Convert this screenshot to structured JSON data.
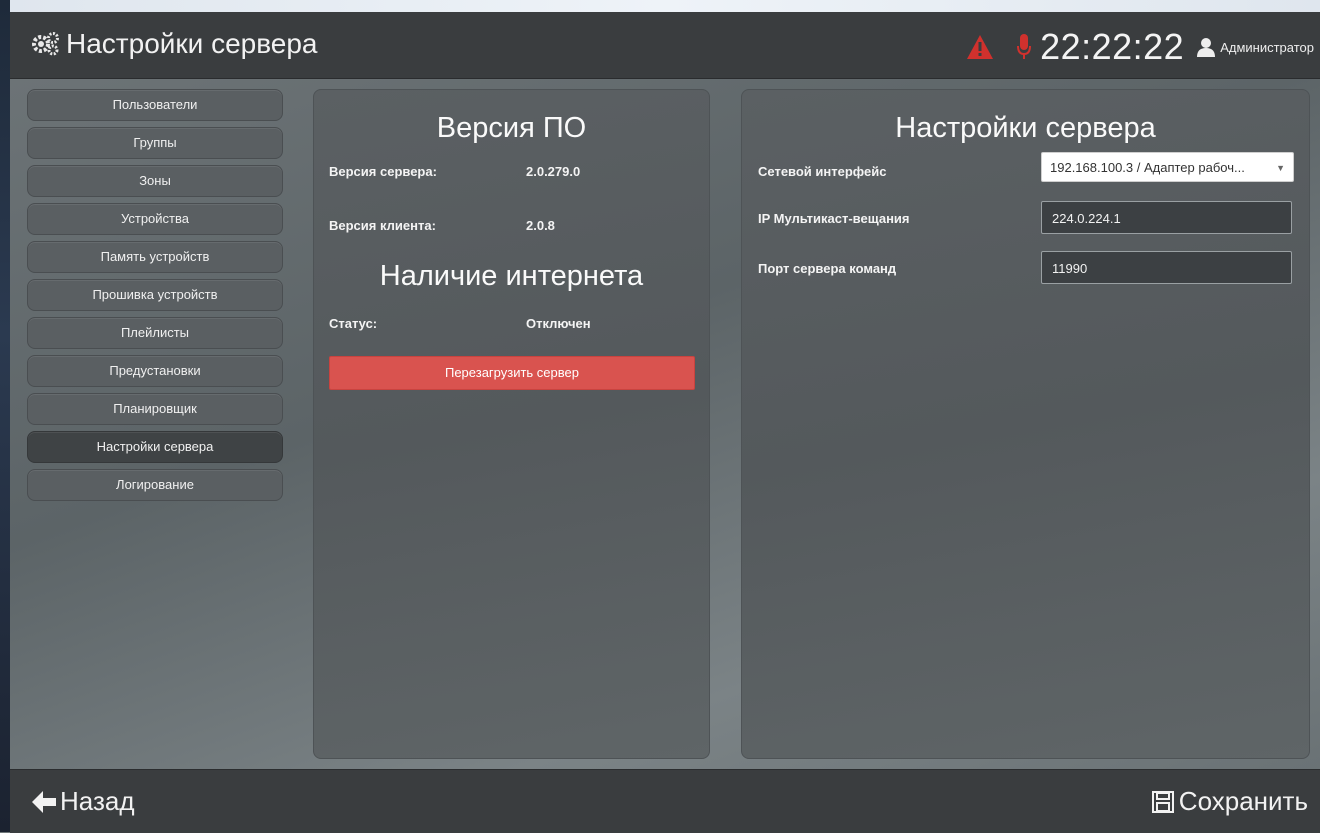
{
  "header": {
    "title": "Настройки сервера",
    "clock": "22:22:22",
    "user": "Администратор",
    "icons": [
      "gears-icon",
      "warning-icon",
      "microphone-icon",
      "user-icon"
    ],
    "alert_color": "#d0312d"
  },
  "sidebar": {
    "items": [
      {
        "label": "Пользователи",
        "active": false
      },
      {
        "label": "Группы",
        "active": false
      },
      {
        "label": "Зоны",
        "active": false
      },
      {
        "label": "Устройства",
        "active": false
      },
      {
        "label": "Память устройств",
        "active": false
      },
      {
        "label": "Прошивка устройств",
        "active": false
      },
      {
        "label": "Плейлисты",
        "active": false
      },
      {
        "label": "Предустановки",
        "active": false
      },
      {
        "label": "Планировщик",
        "active": false
      },
      {
        "label": "Настройки сервера",
        "active": true
      },
      {
        "label": "Логирование",
        "active": false
      }
    ]
  },
  "version_panel": {
    "title": "Версия ПО",
    "server_label": "Версия сервера:",
    "server_value": "2.0.279.0",
    "client_label": "Версия клиента:",
    "client_value": "2.0.8",
    "internet_title": "Наличие интернета",
    "status_label": "Статус:",
    "status_value": "Отключен",
    "reboot_button": "Перезагрузить сервер",
    "reboot_color": "#d9534f"
  },
  "settings_panel": {
    "title": "Настройки сервера",
    "network_label": "Сетевой интерфейс",
    "network_value": "192.168.100.3 / Адаптер рабоч...",
    "multicast_label": "IP Мультикаст-вещания",
    "multicast_value": "224.0.224.1",
    "port_label": "Порт сервера команд",
    "port_value": "11990"
  },
  "footer": {
    "back_label": "Назад",
    "save_label": "Сохранить",
    "icons": [
      "arrow-left-icon",
      "save-icon"
    ]
  }
}
